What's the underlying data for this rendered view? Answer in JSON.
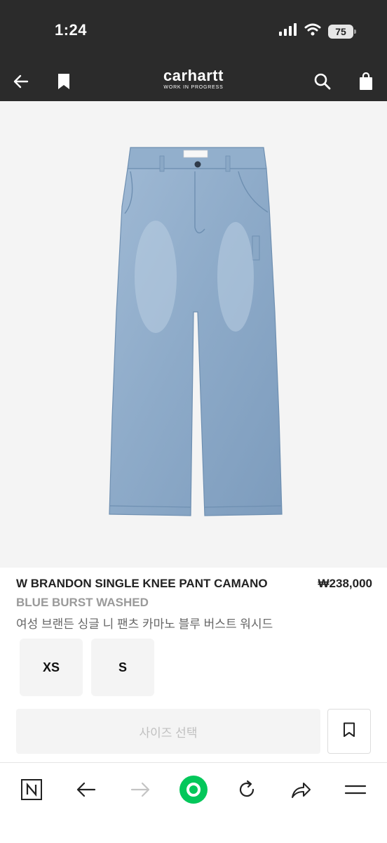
{
  "status_bar": {
    "time": "1:24",
    "battery": "75"
  },
  "header": {
    "logo_main": "carhartt",
    "logo_sub": "WORK IN PROGRESS",
    "icons": [
      "back-arrow-icon",
      "bookmark-icon",
      "search-icon",
      "shopping-bag-icon"
    ]
  },
  "product": {
    "name": "W BRANDON SINGLE KNEE PANT CAMANO",
    "price": "₩238,000",
    "color": "BLUE BURST WASHED",
    "name_ko": "여성 브랜든 싱글 니 팬츠 카마노 블루 버스트 워시드",
    "sizes": [
      {
        "label": "XS"
      },
      {
        "label": "S"
      }
    ],
    "select_size_label": "사이즈 선택"
  },
  "browser_toolbar": {
    "icons": [
      "naver-home-icon",
      "back-arrow-icon",
      "forward-arrow-icon",
      "green-dot-icon",
      "reload-icon",
      "share-icon",
      "menu-icon"
    ]
  },
  "colors": {
    "header_bg": "#2b2b2b",
    "image_bg": "#f4f4f4",
    "accent_green": "#03c75a",
    "muted_text": "#9a9a9a"
  }
}
